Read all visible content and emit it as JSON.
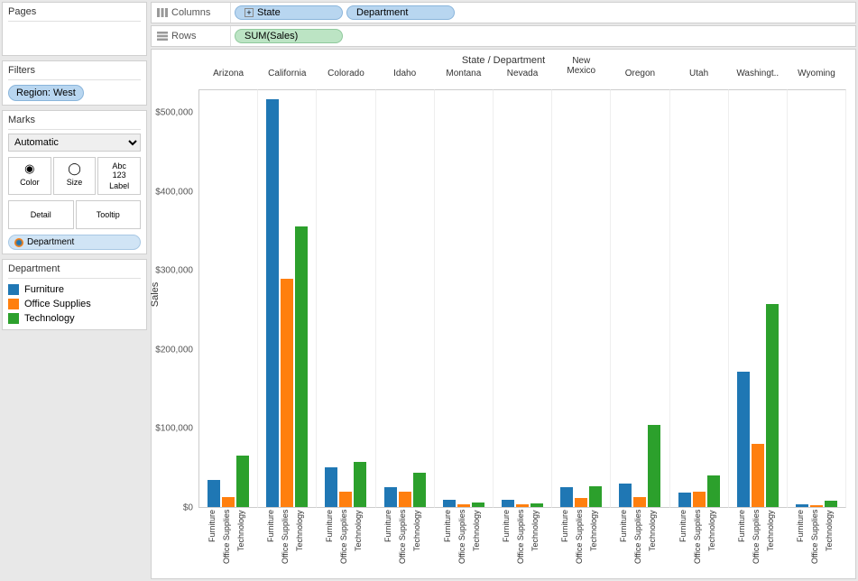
{
  "sidebar": {
    "pages_label": "Pages",
    "filters_label": "Filters",
    "filter_value": "Region: West",
    "marks_label": "Marks",
    "marks_type": "Automatic",
    "mark_buttons": [
      "Color",
      "Size",
      "Label",
      "Detail",
      "Tooltip"
    ],
    "mark_pill": "Department",
    "legend_title": "Department"
  },
  "shelves": {
    "columns_label": "Columns",
    "rows_label": "Rows",
    "col_pill1": "State",
    "col_pill2": "Department",
    "row_pill1": "SUM(Sales)"
  },
  "viz_title": "State  /  Department",
  "yaxis_label": "Sales",
  "legend": [
    {
      "name": "Furniture",
      "color": "#1f77b4"
    },
    {
      "name": "Office Supplies",
      "color": "#ff7f0e"
    },
    {
      "name": "Technology",
      "color": "#2ca02c"
    }
  ],
  "chart_data": {
    "type": "bar",
    "ylabel": "Sales",
    "ylim": [
      0,
      530000
    ],
    "yticks": [
      0,
      100000,
      200000,
      300000,
      400000,
      500000
    ],
    "ytick_labels": [
      "$0",
      "$100,000",
      "$200,000",
      "$300,000",
      "$400,000",
      "$500,000"
    ],
    "departments": [
      "Furniture",
      "Office Supplies",
      "Technology"
    ],
    "states": [
      {
        "name": "Arizona",
        "head": "Arizona",
        "values": [
          35000,
          13000,
          65000
        ]
      },
      {
        "name": "California",
        "head": "California",
        "values": [
          518000,
          290000,
          357000
        ]
      },
      {
        "name": "Colorado",
        "head": "Colorado",
        "values": [
          50000,
          20000,
          57000
        ]
      },
      {
        "name": "Idaho",
        "head": "Idaho",
        "values": [
          25000,
          19000,
          44000
        ]
      },
      {
        "name": "Montana",
        "head": "Montana",
        "values": [
          9000,
          4000,
          6000
        ]
      },
      {
        "name": "Nevada",
        "head": "Nevada",
        "values": [
          9000,
          4000,
          5000
        ]
      },
      {
        "name": "New Mexico",
        "head": "New\nMexico",
        "values": [
          25000,
          11000,
          26000
        ]
      },
      {
        "name": "Oregon",
        "head": "Oregon",
        "values": [
          30000,
          13000,
          104000
        ]
      },
      {
        "name": "Utah",
        "head": "Utah",
        "values": [
          18000,
          20000,
          40000
        ]
      },
      {
        "name": "Washington",
        "head": "Washingt..",
        "values": [
          172000,
          80000,
          258000
        ]
      },
      {
        "name": "Wyoming",
        "head": "Wyoming",
        "values": [
          3000,
          2000,
          8000
        ]
      }
    ]
  }
}
